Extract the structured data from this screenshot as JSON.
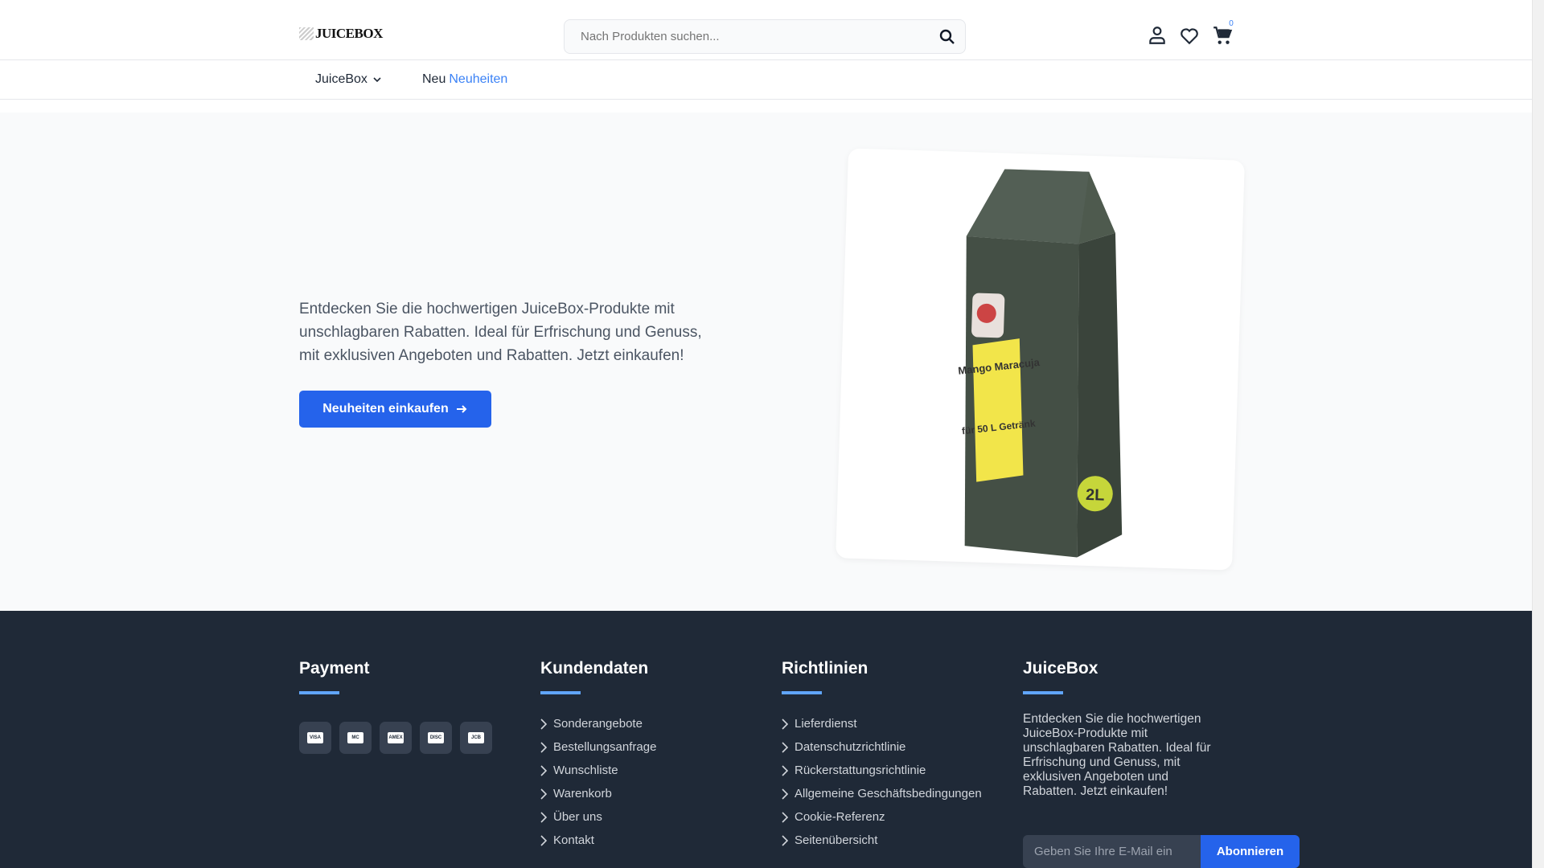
{
  "header": {
    "logo": "JUICEBOX",
    "search_placeholder": "Nach Produkten suchen...",
    "cart_count": "0"
  },
  "nav": {
    "juicebox": "JuiceBox",
    "new_prefix": "Neu",
    "new_link": "Neuheiten"
  },
  "hero": {
    "text": "Entdecken Sie die hochwertigen JuiceBox-Produkte mit unschlagbaren Rabatten. Ideal für Erfrischung und Genuss, mit exklusiven Angeboten und Rabatten. Jetzt einkaufen!",
    "button": "Neuheiten einkaufen",
    "product_label": "Mango Maracuja",
    "product_sub": "für 50 L Getränk",
    "product_size": "2L"
  },
  "footer": {
    "payment": {
      "title": "Payment",
      "cards": [
        "VISA",
        "MC",
        "AMEX",
        "DISC",
        "JCB"
      ]
    },
    "kundendaten": {
      "title": "Kundendaten",
      "links": [
        "Sonderangebote",
        "Bestellungsanfrage",
        "Wunschliste",
        "Warenkorb",
        "Über uns",
        "Kontakt"
      ]
    },
    "richtlinien": {
      "title": "Richtlinien",
      "links": [
        "Lieferdienst",
        "Datenschutzrichtlinie",
        "Rückerstattungsrichtlinie",
        "Allgemeine Geschäftsbedingungen",
        "Cookie-Referenz",
        "Seitenübersicht"
      ]
    },
    "juicebox": {
      "title": "JuiceBox",
      "text": "Entdecken Sie die hochwertigen JuiceBox-Produkte mit unschlagbaren Rabatten. Ideal für Erfrischung und Genuss, mit exklusiven Angeboten und Rabatten. Jetzt einkaufen!",
      "email_placeholder": "Geben Sie Ihre E-Mail ein",
      "subscribe": "Abonnieren"
    }
  }
}
